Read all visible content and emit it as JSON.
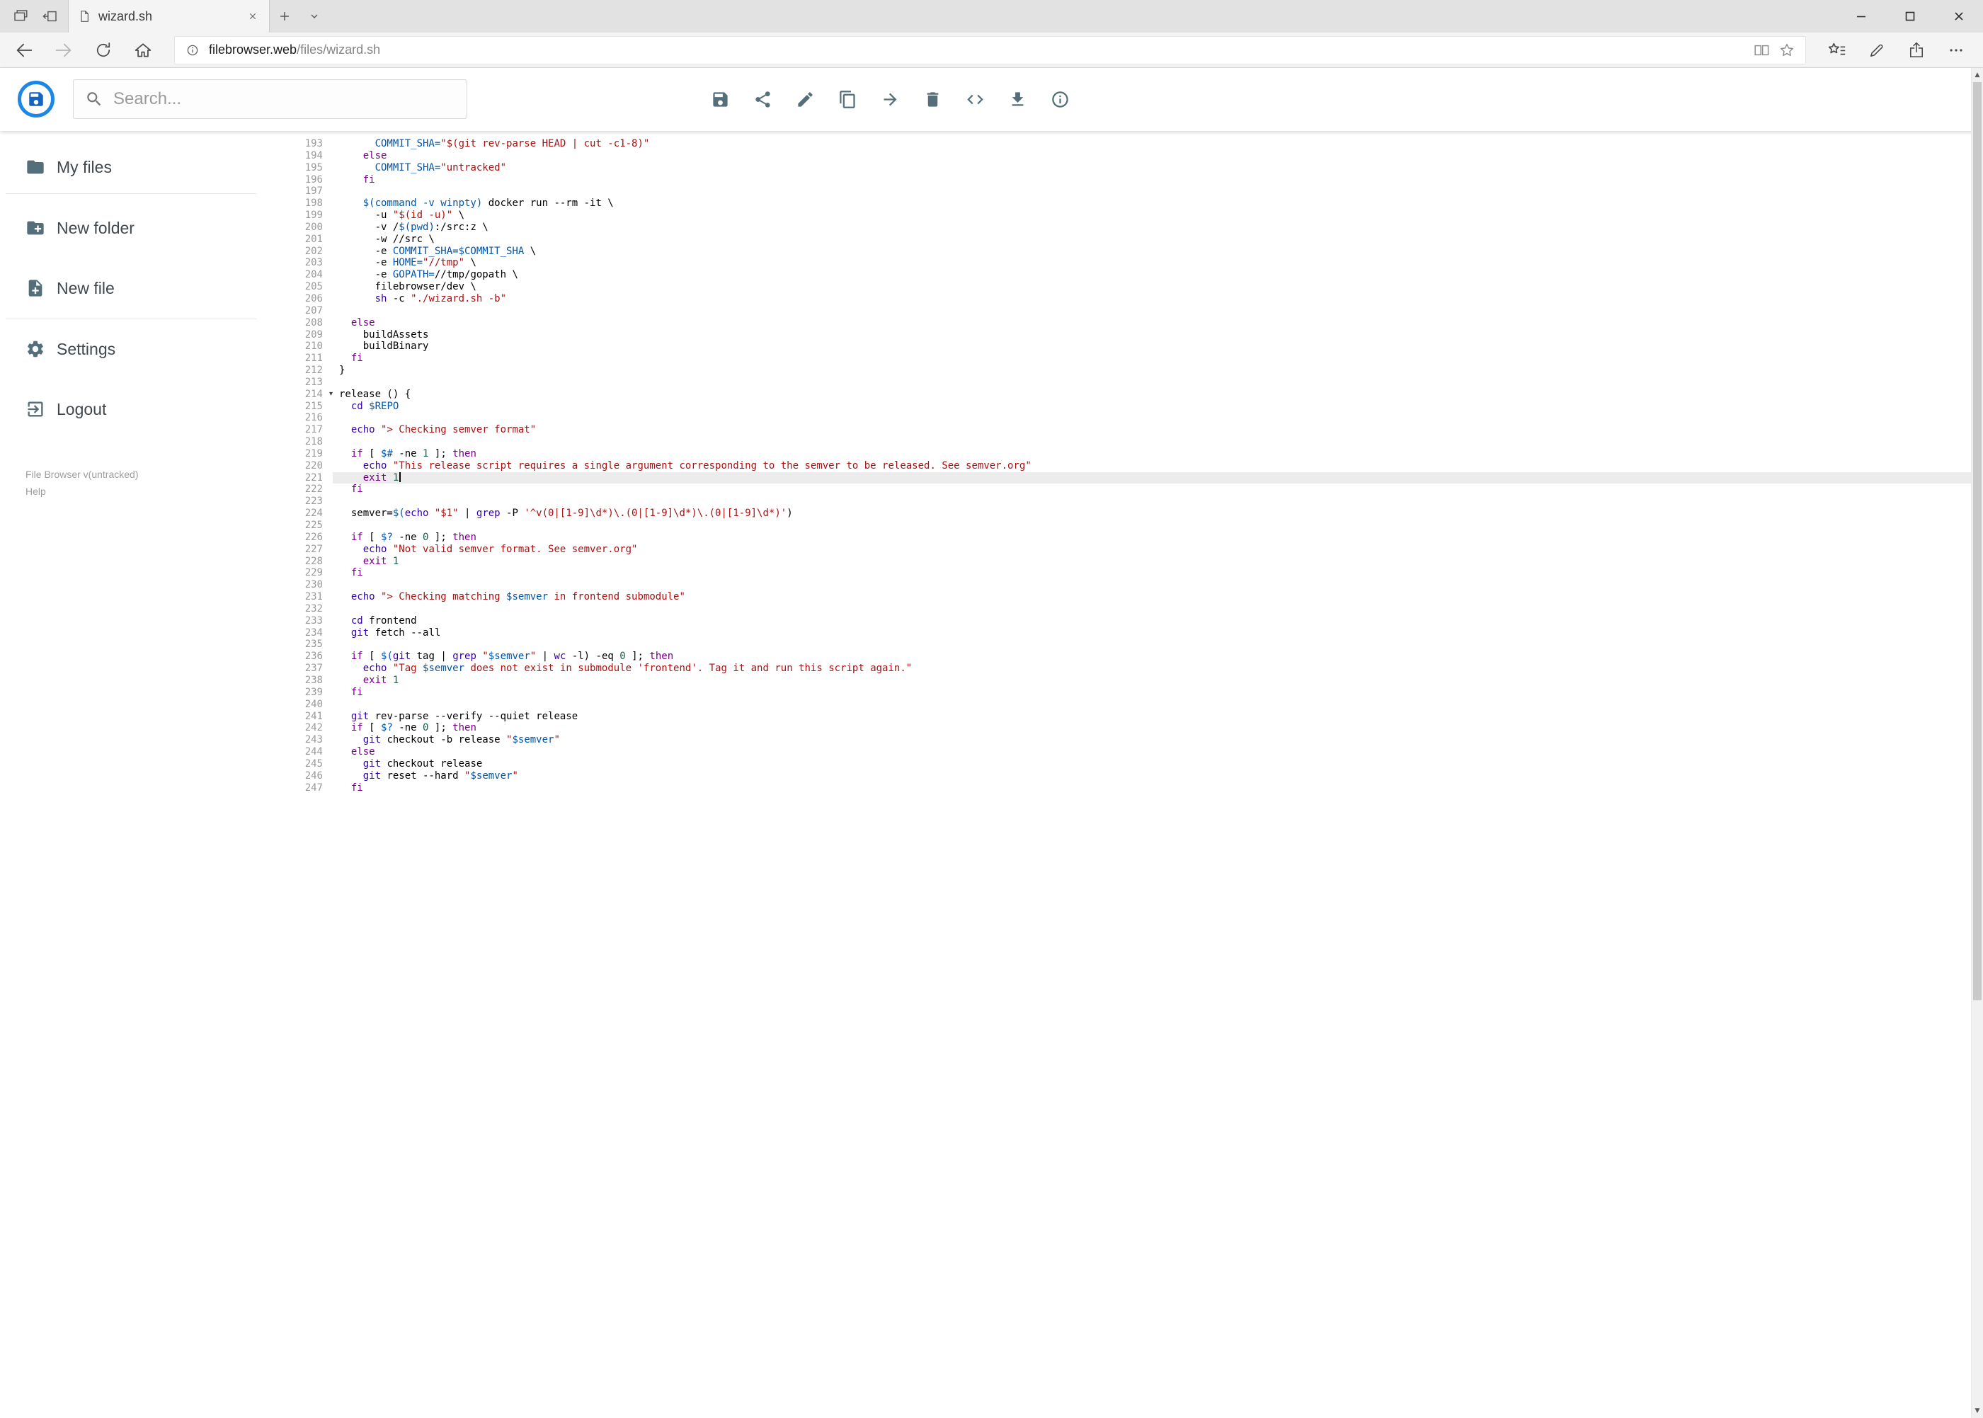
{
  "browser": {
    "tab_title": "wizard.sh",
    "url_host": "filebrowser.web",
    "url_path": "/files/wizard.sh"
  },
  "header": {
    "search_placeholder": "Search...",
    "action_icons": [
      "save",
      "share",
      "rename",
      "copy",
      "move",
      "delete",
      "raw",
      "download",
      "info"
    ]
  },
  "sidebar": {
    "items": [
      {
        "label": "My files"
      },
      {
        "label": "New folder"
      },
      {
        "label": "New file"
      },
      {
        "label": "Settings"
      },
      {
        "label": "Logout"
      }
    ],
    "footer_version": "File Browser v(untracked)",
    "footer_help": "Help"
  },
  "editor": {
    "active_line": 221,
    "fold_line": 214,
    "colors": {
      "plain": "#000000",
      "keyword": "#770088",
      "builtin": "#3300aa",
      "variable": "#0055aa",
      "string": "#aa1111",
      "number": "#116644",
      "gutter": "#999999",
      "active_bg": "#ececec"
    },
    "lines": [
      {
        "n": 193,
        "t": [
          [
            "p",
            "      "
          ],
          [
            "v",
            "COMMIT_SHA="
          ],
          [
            "s",
            "\"$(git rev-parse HEAD | cut -c1-8)\""
          ]
        ]
      },
      {
        "n": 194,
        "t": [
          [
            "p",
            "    "
          ],
          [
            "k",
            "else"
          ]
        ]
      },
      {
        "n": 195,
        "t": [
          [
            "p",
            "      "
          ],
          [
            "v",
            "COMMIT_SHA="
          ],
          [
            "s",
            "\"untracked\""
          ]
        ]
      },
      {
        "n": 196,
        "t": [
          [
            "p",
            "    "
          ],
          [
            "k",
            "fi"
          ]
        ]
      },
      {
        "n": 197,
        "t": []
      },
      {
        "n": 198,
        "t": [
          [
            "p",
            "    "
          ],
          [
            "v",
            "$(command -v winpty)"
          ],
          [
            "p",
            " docker run --rm -it \\"
          ]
        ]
      },
      {
        "n": 199,
        "t": [
          [
            "p",
            "      -u "
          ],
          [
            "s",
            "\"$(id -u)\""
          ],
          [
            "p",
            " \\"
          ]
        ]
      },
      {
        "n": 200,
        "t": [
          [
            "p",
            "      -v /"
          ],
          [
            "v",
            "$(pwd)"
          ],
          [
            "p",
            ":/src:z \\"
          ]
        ]
      },
      {
        "n": 201,
        "t": [
          [
            "p",
            "      -w //src \\"
          ]
        ]
      },
      {
        "n": 202,
        "t": [
          [
            "p",
            "      -e "
          ],
          [
            "v",
            "COMMIT_SHA=$COMMIT_SHA"
          ],
          [
            "p",
            " \\"
          ]
        ]
      },
      {
        "n": 203,
        "t": [
          [
            "p",
            "      -e "
          ],
          [
            "v",
            "HOME="
          ],
          [
            "s",
            "\"//tmp\""
          ],
          [
            "p",
            " \\"
          ]
        ]
      },
      {
        "n": 204,
        "t": [
          [
            "p",
            "      -e "
          ],
          [
            "v",
            "GOPATH="
          ],
          [
            "p",
            "//tmp/gopath \\"
          ]
        ]
      },
      {
        "n": 205,
        "t": [
          [
            "p",
            "      filebrowser/dev \\"
          ]
        ]
      },
      {
        "n": 206,
        "t": [
          [
            "p",
            "      "
          ],
          [
            "b",
            "sh"
          ],
          [
            "p",
            " -c "
          ],
          [
            "s",
            "\"./wizard.sh -b\""
          ]
        ]
      },
      {
        "n": 207,
        "t": []
      },
      {
        "n": 208,
        "t": [
          [
            "p",
            "  "
          ],
          [
            "k",
            "else"
          ]
        ]
      },
      {
        "n": 209,
        "t": [
          [
            "p",
            "    buildAssets"
          ]
        ]
      },
      {
        "n": 210,
        "t": [
          [
            "p",
            "    buildBinary"
          ]
        ]
      },
      {
        "n": 211,
        "t": [
          [
            "p",
            "  "
          ],
          [
            "k",
            "fi"
          ]
        ]
      },
      {
        "n": 212,
        "t": [
          [
            "p",
            "}"
          ]
        ]
      },
      {
        "n": 213,
        "t": []
      },
      {
        "n": 214,
        "t": [
          [
            "p",
            "release () {"
          ]
        ]
      },
      {
        "n": 215,
        "t": [
          [
            "p",
            "  "
          ],
          [
            "b",
            "cd"
          ],
          [
            "p",
            " "
          ],
          [
            "v",
            "$REPO"
          ]
        ]
      },
      {
        "n": 216,
        "t": []
      },
      {
        "n": 217,
        "t": [
          [
            "p",
            "  "
          ],
          [
            "b",
            "echo"
          ],
          [
            "p",
            " "
          ],
          [
            "s",
            "\"> Checking semver format\""
          ]
        ]
      },
      {
        "n": 218,
        "t": []
      },
      {
        "n": 219,
        "t": [
          [
            "p",
            "  "
          ],
          [
            "k",
            "if"
          ],
          [
            "p",
            " [ "
          ],
          [
            "v",
            "$#"
          ],
          [
            "p",
            " -ne "
          ],
          [
            "num",
            "1"
          ],
          [
            "p",
            " ]; "
          ],
          [
            "k",
            "then"
          ]
        ]
      },
      {
        "n": 220,
        "t": [
          [
            "p",
            "    "
          ],
          [
            "b",
            "echo"
          ],
          [
            "p",
            " "
          ],
          [
            "s",
            "\"This release script requires a single argument corresponding to the semver to be released. See semver.org\""
          ]
        ]
      },
      {
        "n": 221,
        "t": [
          [
            "p",
            "    "
          ],
          [
            "k",
            "exit"
          ],
          [
            "p",
            " "
          ],
          [
            "num",
            "1"
          ]
        ]
      },
      {
        "n": 222,
        "t": [
          [
            "p",
            "  "
          ],
          [
            "k",
            "fi"
          ]
        ]
      },
      {
        "n": 223,
        "t": []
      },
      {
        "n": 224,
        "t": [
          [
            "p",
            "  semver="
          ],
          [
            "v",
            "$("
          ],
          [
            "b",
            "echo"
          ],
          [
            "p",
            " "
          ],
          [
            "s",
            "\"$1\""
          ],
          [
            "p",
            " | "
          ],
          [
            "b",
            "grep"
          ],
          [
            "p",
            " -P "
          ],
          [
            "s",
            "'^v(0|[1-9]\\d*)\\.(0|[1-9]\\d*)\\.(0|[1-9]\\d*)'"
          ],
          [
            "p",
            ")"
          ]
        ]
      },
      {
        "n": 225,
        "t": []
      },
      {
        "n": 226,
        "t": [
          [
            "p",
            "  "
          ],
          [
            "k",
            "if"
          ],
          [
            "p",
            " [ "
          ],
          [
            "v",
            "$?"
          ],
          [
            "p",
            " -ne "
          ],
          [
            "num",
            "0"
          ],
          [
            "p",
            " ]; "
          ],
          [
            "k",
            "then"
          ]
        ]
      },
      {
        "n": 227,
        "t": [
          [
            "p",
            "    "
          ],
          [
            "b",
            "echo"
          ],
          [
            "p",
            " "
          ],
          [
            "s",
            "\"Not valid semver format. See semver.org\""
          ]
        ]
      },
      {
        "n": 228,
        "t": [
          [
            "p",
            "    "
          ],
          [
            "k",
            "exit"
          ],
          [
            "p",
            " "
          ],
          [
            "num",
            "1"
          ]
        ]
      },
      {
        "n": 229,
        "t": [
          [
            "p",
            "  "
          ],
          [
            "k",
            "fi"
          ]
        ]
      },
      {
        "n": 230,
        "t": []
      },
      {
        "n": 231,
        "t": [
          [
            "p",
            "  "
          ],
          [
            "b",
            "echo"
          ],
          [
            "p",
            " "
          ],
          [
            "s",
            "\"> Checking matching "
          ],
          [
            "v",
            "$semver"
          ],
          [
            "s",
            " in frontend submodule\""
          ]
        ]
      },
      {
        "n": 232,
        "t": []
      },
      {
        "n": 233,
        "t": [
          [
            "p",
            "  "
          ],
          [
            "b",
            "cd"
          ],
          [
            "p",
            " frontend"
          ]
        ]
      },
      {
        "n": 234,
        "t": [
          [
            "p",
            "  "
          ],
          [
            "b",
            "git"
          ],
          [
            "p",
            " fetch --all"
          ]
        ]
      },
      {
        "n": 235,
        "t": []
      },
      {
        "n": 236,
        "t": [
          [
            "p",
            "  "
          ],
          [
            "k",
            "if"
          ],
          [
            "p",
            " [ "
          ],
          [
            "v",
            "$("
          ],
          [
            "b",
            "git"
          ],
          [
            "p",
            " tag | "
          ],
          [
            "b",
            "grep"
          ],
          [
            "p",
            " "
          ],
          [
            "s",
            "\""
          ],
          [
            "v",
            "$semver"
          ],
          [
            "s",
            "\""
          ],
          [
            "p",
            " | "
          ],
          [
            "b",
            "wc"
          ],
          [
            "p",
            " -l) -eq "
          ],
          [
            "num",
            "0"
          ],
          [
            "p",
            " ]; "
          ],
          [
            "k",
            "then"
          ]
        ]
      },
      {
        "n": 237,
        "t": [
          [
            "p",
            "    "
          ],
          [
            "b",
            "echo"
          ],
          [
            "p",
            " "
          ],
          [
            "s",
            "\"Tag "
          ],
          [
            "v",
            "$semver"
          ],
          [
            "s",
            " does not exist in submodule 'frontend'. Tag it and run this script again.\""
          ]
        ]
      },
      {
        "n": 238,
        "t": [
          [
            "p",
            "    "
          ],
          [
            "k",
            "exit"
          ],
          [
            "p",
            " "
          ],
          [
            "num",
            "1"
          ]
        ]
      },
      {
        "n": 239,
        "t": [
          [
            "p",
            "  "
          ],
          [
            "k",
            "fi"
          ]
        ]
      },
      {
        "n": 240,
        "t": []
      },
      {
        "n": 241,
        "t": [
          [
            "p",
            "  "
          ],
          [
            "b",
            "git"
          ],
          [
            "p",
            " rev-parse --verify --quiet release"
          ]
        ]
      },
      {
        "n": 242,
        "t": [
          [
            "p",
            "  "
          ],
          [
            "k",
            "if"
          ],
          [
            "p",
            " [ "
          ],
          [
            "v",
            "$?"
          ],
          [
            "p",
            " -ne "
          ],
          [
            "num",
            "0"
          ],
          [
            "p",
            " ]; "
          ],
          [
            "k",
            "then"
          ]
        ]
      },
      {
        "n": 243,
        "t": [
          [
            "p",
            "    "
          ],
          [
            "b",
            "git"
          ],
          [
            "p",
            " checkout -b release "
          ],
          [
            "s",
            "\""
          ],
          [
            "v",
            "$semver"
          ],
          [
            "s",
            "\""
          ]
        ]
      },
      {
        "n": 244,
        "t": [
          [
            "p",
            "  "
          ],
          [
            "k",
            "else"
          ]
        ]
      },
      {
        "n": 245,
        "t": [
          [
            "p",
            "    "
          ],
          [
            "b",
            "git"
          ],
          [
            "p",
            " checkout release"
          ]
        ]
      },
      {
        "n": 246,
        "t": [
          [
            "p",
            "    "
          ],
          [
            "b",
            "git"
          ],
          [
            "p",
            " reset --hard "
          ],
          [
            "s",
            "\""
          ],
          [
            "v",
            "$semver"
          ],
          [
            "s",
            "\""
          ]
        ]
      },
      {
        "n": 247,
        "t": [
          [
            "p",
            "  "
          ],
          [
            "k",
            "fi"
          ]
        ]
      }
    ]
  }
}
